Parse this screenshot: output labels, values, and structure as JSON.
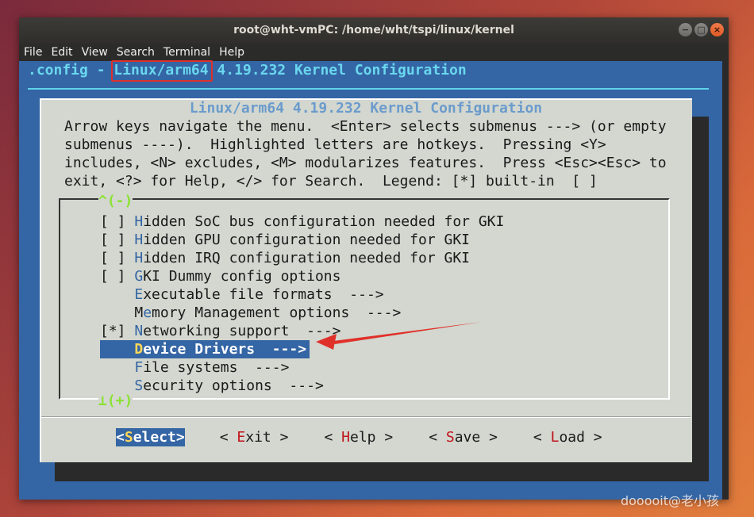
{
  "window": {
    "title": "root@wht-vmPC: /home/wht/tspi/linux/kernel",
    "controls": [
      "−",
      "□",
      "×"
    ]
  },
  "menubar": [
    "File",
    "Edit",
    "View",
    "Search",
    "Terminal",
    "Help"
  ],
  "terminal": {
    "topline_prefix": ".config - ",
    "topline_highlight": "Linux/arm64",
    "topline_suffix": " 4.19.232 Kernel Configuration",
    "dialog_title": "Linux/arm64 4.19.232 Kernel Configuration",
    "help_lines": [
      "Arrow keys navigate the menu.  <Enter> selects submenus ---> (or empty",
      "submenus ----).  Highlighted letters are hotkeys.  Pressing <Y>",
      "includes, <N> excludes, <M> modularizes features.  Press <Esc><Esc> to",
      "exit, <?> for Help, </> for Search.  Legend: [*] built-in  [ ]"
    ],
    "scroll_up": "^(-)",
    "scroll_down": "⊥(+)",
    "items": [
      {
        "prefix": "[ ] ",
        "hotkey": "H",
        "rest": "idden SoC bus configuration needed for GKI"
      },
      {
        "prefix": "[ ] ",
        "hotkey": "H",
        "rest": "idden GPU configuration needed for GKI"
      },
      {
        "prefix": "[ ] ",
        "hotkey": "H",
        "rest": "idden IRQ configuration needed for GKI"
      },
      {
        "prefix": "[ ] ",
        "hotkey": "G",
        "rest": "KI Dummy config options"
      },
      {
        "prefix": "    ",
        "hotkey": "E",
        "rest": "xecutable file formats  --->"
      },
      {
        "prefix": "    ",
        "hotkey": "",
        "pre": "M",
        "hk2": "e",
        "rest": "mory Management options  --->"
      },
      {
        "prefix": "[*] ",
        "hotkey": "N",
        "rest": "etworking support  --->"
      },
      {
        "prefix": "    ",
        "hotkey": "D",
        "rest": "evice Drivers  --->",
        "selected": true
      },
      {
        "prefix": "    ",
        "hotkey": "F",
        "rest": "ile systems  --->"
      },
      {
        "prefix": "    ",
        "hotkey": "S",
        "rest": "ecurity options  --->"
      }
    ],
    "buttons": [
      {
        "open": "<",
        "hotkey": "S",
        "rest": "elect",
        "close": ">",
        "selected": true
      },
      {
        "open": "< ",
        "hotkey": "E",
        "rest": "xit",
        "close": " >"
      },
      {
        "open": "< ",
        "hotkey": "H",
        "rest": "elp",
        "close": " >"
      },
      {
        "open": "< ",
        "hotkey": "S",
        "rest": "ave",
        "close": " >"
      },
      {
        "open": "< ",
        "hotkey": "L",
        "rest": "oad",
        "close": " >"
      }
    ]
  },
  "annotation_color": "#e0302a",
  "watermark": "dooooit@老小孩"
}
